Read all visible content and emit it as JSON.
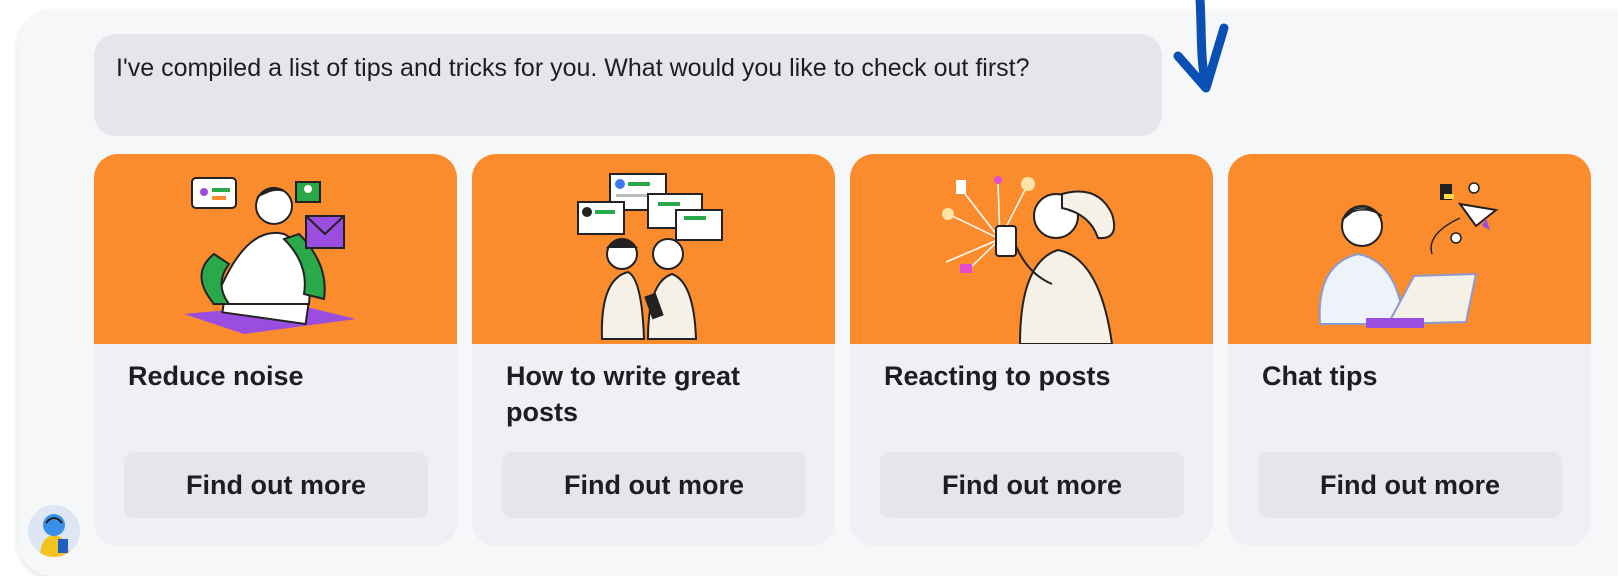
{
  "message": {
    "text": "I've compiled a list of tips and tricks for you. What would you like to check out first?"
  },
  "cards": [
    {
      "title": "Reduce noise",
      "button_label": "Find out more"
    },
    {
      "title": "How to write great posts",
      "button_label": "Find out more"
    },
    {
      "title": "Reacting to posts",
      "button_label": "Find out more"
    },
    {
      "title": "Chat tips",
      "button_label": "Find out more"
    }
  ],
  "colors": {
    "card_art_background": "#fb8c2d",
    "arrow": "#0a4fb4",
    "bubble": "#e4e6eb"
  },
  "icons": {
    "arrow": "arrow-down-icon",
    "avatar": "assistant-avatar-icon"
  }
}
